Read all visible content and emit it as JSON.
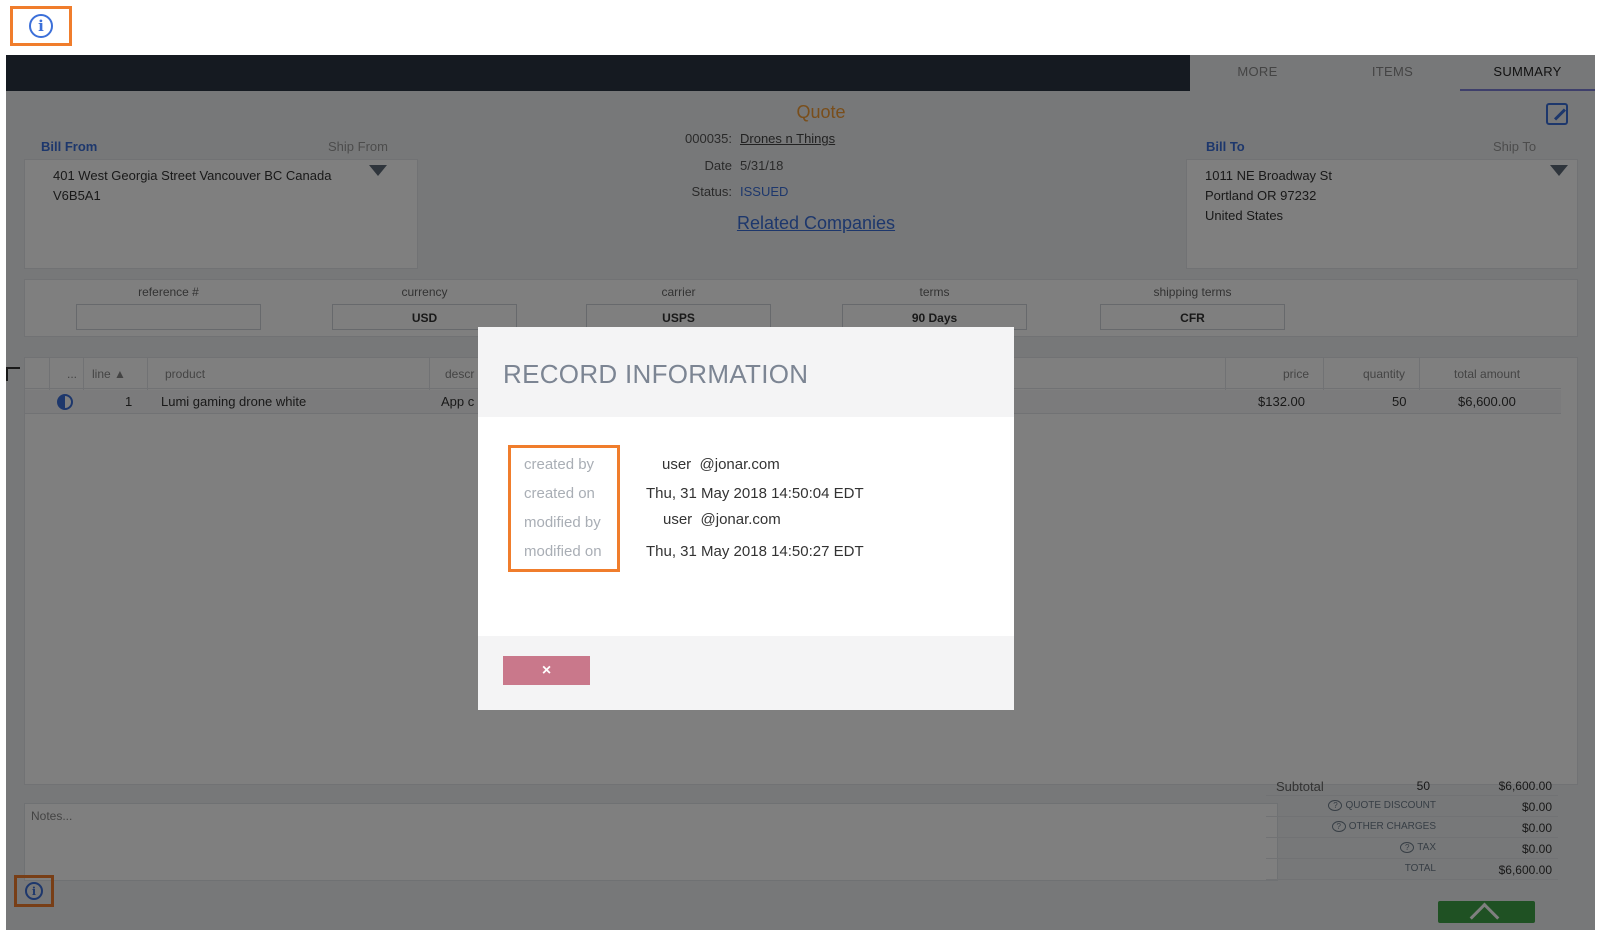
{
  "tabs": [
    {
      "label": "MORE"
    },
    {
      "label": "ITEMS"
    },
    {
      "label": "SUMMARY"
    }
  ],
  "quote": {
    "title": "Quote",
    "number_label": "000035:",
    "company": "Drones n Things",
    "date_label": "Date",
    "date": "5/31/18",
    "status_label": "Status:",
    "status": "ISSUED",
    "related": "Related Companies"
  },
  "bill_from": {
    "label": "Bill From",
    "ship_label": "Ship From",
    "address_line1": "401 West Georgia Street Vancouver BC Canada",
    "address_line2": "V6B5A1"
  },
  "bill_to": {
    "label": "Bill To",
    "ship_label": "Ship To",
    "address_line1": "1011 NE Broadway St",
    "address_line2": "Portland OR 97232",
    "address_line3": "United States"
  },
  "fields": {
    "reference_label": "reference #",
    "reference_value": "",
    "currency_label": "currency",
    "currency_value": "USD",
    "carrier_label": "carrier",
    "carrier_value": "USPS",
    "terms_label": "terms",
    "terms_value": "90 Days",
    "shipping_terms_label": "shipping terms",
    "shipping_terms_value": "CFR"
  },
  "grid": {
    "headers": {
      "dots": "...",
      "line": "line ▲",
      "product": "product",
      "description": "descr",
      "price": "price",
      "quantity": "quantity",
      "total": "total amount"
    },
    "row": {
      "line": "1",
      "product": "Lumi gaming drone white",
      "description": "App c",
      "price": "$132.00",
      "quantity": "50",
      "total": "$6,600.00"
    }
  },
  "notes_placeholder": "Notes...",
  "totals": {
    "subtotal_label": "Subtotal",
    "subtotal_qty": "50",
    "subtotal_value": "$6,600.00",
    "discount_label": "QUOTE DISCOUNT",
    "discount_value": "$0.00",
    "other_label": "OTHER CHARGES",
    "other_value": "$0.00",
    "tax_label": "TAX",
    "tax_value": "$0.00",
    "total_label": "TOTAL",
    "total_value": "$6,600.00"
  },
  "modal": {
    "title": "RECORD INFORMATION",
    "created_by_label": "created by",
    "created_on_label": "created on",
    "modified_by_label": "modified by",
    "modified_on_label": "modified on",
    "created_by": "user  @jonar.com",
    "created_on": "Thu, 31 May 2018 14:50:04 EDT",
    "modified_by": "user  @jonar.com",
    "modified_on": "Thu, 31 May 2018 14:50:27 EDT",
    "close_label": "×"
  },
  "colors": {
    "highlight": "#f07d2c",
    "accent_blue": "#3b6fd9",
    "quote_orange": "#f39c36",
    "close_button": "#c9788b",
    "green_button": "#3ea346"
  },
  "icons": [
    "info-icon",
    "edit-icon",
    "dropdown-triangle-icon",
    "half-circle-icon",
    "help-icon",
    "chevron-up-icon"
  ]
}
